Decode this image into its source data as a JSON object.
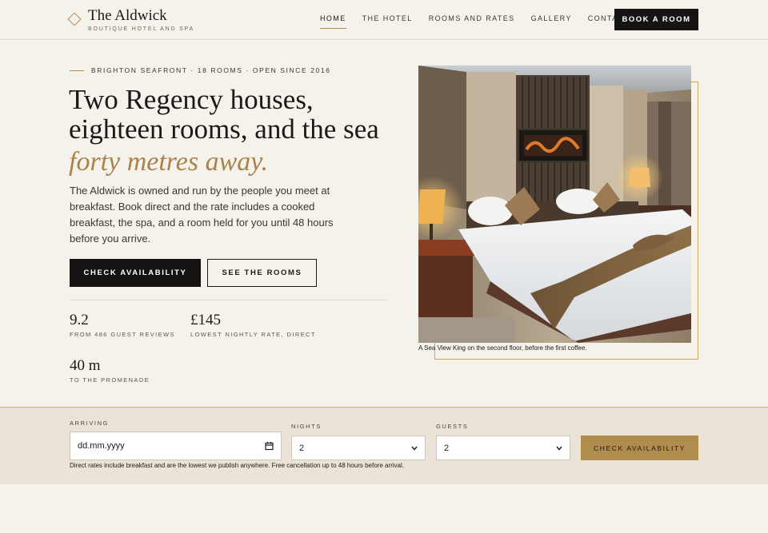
{
  "brand": {
    "name": "The Aldwick",
    "tagline": "BOUTIQUE HOTEL AND SPA"
  },
  "nav": {
    "items": [
      {
        "label": "HOME",
        "active": true
      },
      {
        "label": "THE HOTEL",
        "active": false
      },
      {
        "label": "ROOMS AND RATES",
        "active": false
      },
      {
        "label": "GALLERY",
        "active": false
      },
      {
        "label": "CONTACT",
        "active": false
      }
    ],
    "cta_label": "BOOK A ROOM"
  },
  "hero": {
    "eyebrow": "BRIGHTON SEAFRONT · 18 ROOMS · OPEN SINCE 2016",
    "title_line1": "Two Regency houses,",
    "title_line2": "eighteen rooms, and the sea",
    "title_emphasis": "forty metres away.",
    "lede": "The Aldwick is owned and run by the people you meet at breakfast. Book direct and the rate includes a cooked breakfast, the spa, and a room held for you until 48 hours before you arrive.",
    "primary_cta": "CHECK AVAILABILITY",
    "secondary_cta": "SEE THE ROOMS",
    "stats": [
      {
        "value": "9.2",
        "label": "FROM 486 GUEST REVIEWS"
      },
      {
        "value": "£145",
        "label": "LOWEST NIGHTLY RATE, DIRECT"
      },
      {
        "value": "40 m",
        "label": "TO THE PROMENADE"
      }
    ],
    "image_caption": "A Sea View King on the second floor, before the first coffee."
  },
  "booking": {
    "arriving_label": "ARRIVING",
    "arriving_placeholder": "dd.mm.yyyy",
    "nights_label": "NIGHTS",
    "nights_value": "2",
    "guests_label": "GUESTS",
    "guests_value": "2",
    "submit_label": "CHECK AVAILABILITY",
    "note": "Direct rates include breakfast and are the lowest we publish anywhere. Free cancellation up to 48 hours before arrival."
  },
  "colors": {
    "background": "#f5f1eb",
    "accent_gold": "#b08d4c",
    "ink": "#151412",
    "booking_bar": "#ebe3d7"
  },
  "icons": [
    "diamond-logo-icon",
    "calendar-icon",
    "chevron-down-icon"
  ]
}
